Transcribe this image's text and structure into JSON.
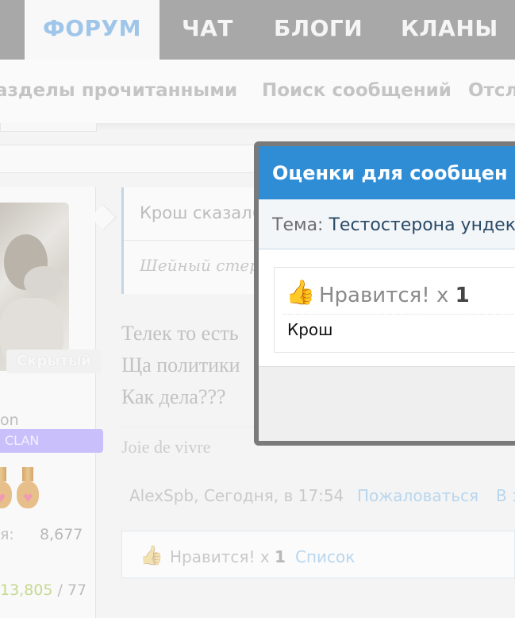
{
  "nav": {
    "tabs": [
      {
        "label": "ФОРУМ",
        "active": true
      },
      {
        "label": "ЧАТ"
      },
      {
        "label": "БЛОГИ"
      },
      {
        "label": "КЛАНЫ"
      }
    ],
    "subnav": [
      "азделы прочитанными",
      "Поиск сообщений",
      "Отсл"
    ]
  },
  "user": {
    "status_badge": "Скрытый",
    "name_fragment": "on",
    "clan_label": "CLAN",
    "stat_label": "я:",
    "stat_value": "8,677",
    "stat2_a": "13,805",
    "stat2_sep": " / ",
    "stat2_b": "77"
  },
  "post": {
    "quote_author": "Крош сказал(",
    "quote_text": "Шейный стер",
    "lines": [
      "Телек то есть",
      "Ща политики",
      "Как дела???"
    ],
    "signature": "Joie de vivre",
    "meta_author_time": "AlexSpb, Сегодня, в 17:54",
    "report_link": "Пожаловаться",
    "quote_link": "В з",
    "likes_text": "Нравится! x",
    "likes_count": "1",
    "likes_list_link": "Список"
  },
  "modal": {
    "title": "Оценки для сообщен",
    "topic_label": "Тема:",
    "topic_value": "Тестостерона ундека",
    "like_label": "Нравится! x",
    "like_count": "1",
    "liker": "Крош"
  },
  "colors": {
    "modal_header": "#2f8dd6",
    "nav_bg": "#a8a8a8",
    "nav_active_text": "#9fc6ea"
  }
}
